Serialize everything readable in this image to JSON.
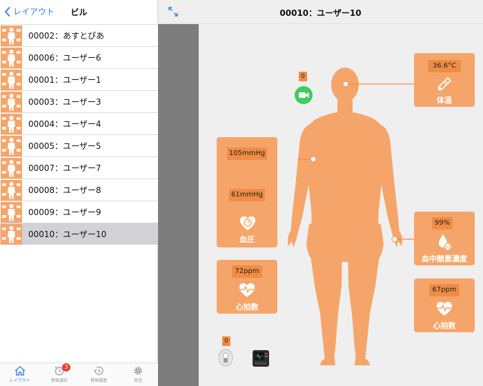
{
  "sidebar": {
    "back_label": "レイアウト",
    "title": "ビル",
    "users": [
      {
        "label": "00002：あすとぴあ",
        "selected": false
      },
      {
        "label": "00006：ユーザー6",
        "selected": false
      },
      {
        "label": "00001：ユーザー1",
        "selected": false
      },
      {
        "label": "00003：ユーザー3",
        "selected": false
      },
      {
        "label": "00004：ユーザー4",
        "selected": false
      },
      {
        "label": "00005：ユーザー5",
        "selected": false
      },
      {
        "label": "00007：ユーザー7",
        "selected": false
      },
      {
        "label": "00008：ユーザー8",
        "selected": false
      },
      {
        "label": "00009：ユーザー9",
        "selected": false
      },
      {
        "label": "00010：ユーザー10",
        "selected": true
      }
    ]
  },
  "tabbar": {
    "tabs": [
      {
        "label": "レイアウト",
        "icon": "home-icon",
        "active": true
      },
      {
        "label": "警報通知",
        "icon": "alarm-clock-icon",
        "badge": "3"
      },
      {
        "label": "警報履歴",
        "icon": "history-icon"
      },
      {
        "label": "設定",
        "icon": "gear-icon"
      }
    ]
  },
  "header": {
    "title": "00010：ユーザー10"
  },
  "vitals": {
    "temperature": {
      "value": "36.6°C",
      "label": "体温"
    },
    "blood_pressure": {
      "systolic": "105mmHg",
      "diastolic": "61mmHg",
      "label": "血圧"
    },
    "pulse_left": {
      "value": "72ppm",
      "label": "心拍数"
    },
    "spo2": {
      "value": "99%",
      "label": "血中酸素濃度"
    },
    "pulse_right": {
      "value": "67ppm",
      "label": "心拍数"
    },
    "camera_count": "0",
    "sensor_count": "0"
  },
  "colors": {
    "accent": "#2f7cf6",
    "card": "#f6a56a",
    "pill": "#f08c45",
    "body": "#f6a56a",
    "selected_row": "#d1d1d6",
    "camera": "#3dcc5e"
  }
}
